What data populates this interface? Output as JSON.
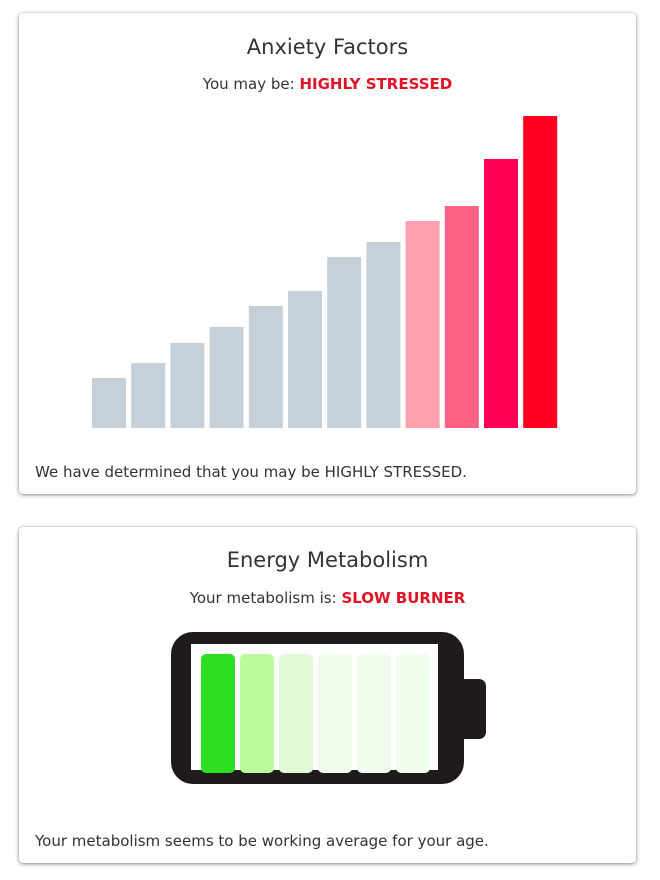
{
  "anxiety": {
    "title": "Anxiety Factors",
    "subtitle_prefix": "You may be:",
    "level": "HIGHLY STRESSED",
    "footer": "We have determined that you may be HIGHLY STRESSED.",
    "chart_data": {
      "type": "bar",
      "title": "",
      "xlabel": "",
      "ylabel": "",
      "values": [
        50,
        65,
        85,
        101,
        122,
        137,
        171,
        186,
        207,
        222,
        269,
        312
      ],
      "colors": [
        "#c6d0d8",
        "#c6d0d8",
        "#c6d0d8",
        "#c6d0d8",
        "#c6d0d8",
        "#c6d0d8",
        "#c6d0d8",
        "#c6d0d8",
        "#ffa0ae",
        "#ff6185",
        "#ff0055",
        "#ff0022"
      ],
      "highlighted_from_index": 8,
      "ylim": [
        0,
        312
      ],
      "grid": false
    }
  },
  "energy": {
    "title": "Energy Metabolism",
    "subtitle_prefix": "Your metabolism is:",
    "level": "SLOW BURNER",
    "footer": "Your metabolism seems to be working average for your age.",
    "battery": {
      "total_cells": 6,
      "filled_cells": 1,
      "cell_colors": [
        "#2ddf21",
        "#bbfb9d",
        "#e0fbd6",
        "#f1fdec",
        "#f1fdec",
        "#f1fdec"
      ]
    }
  }
}
